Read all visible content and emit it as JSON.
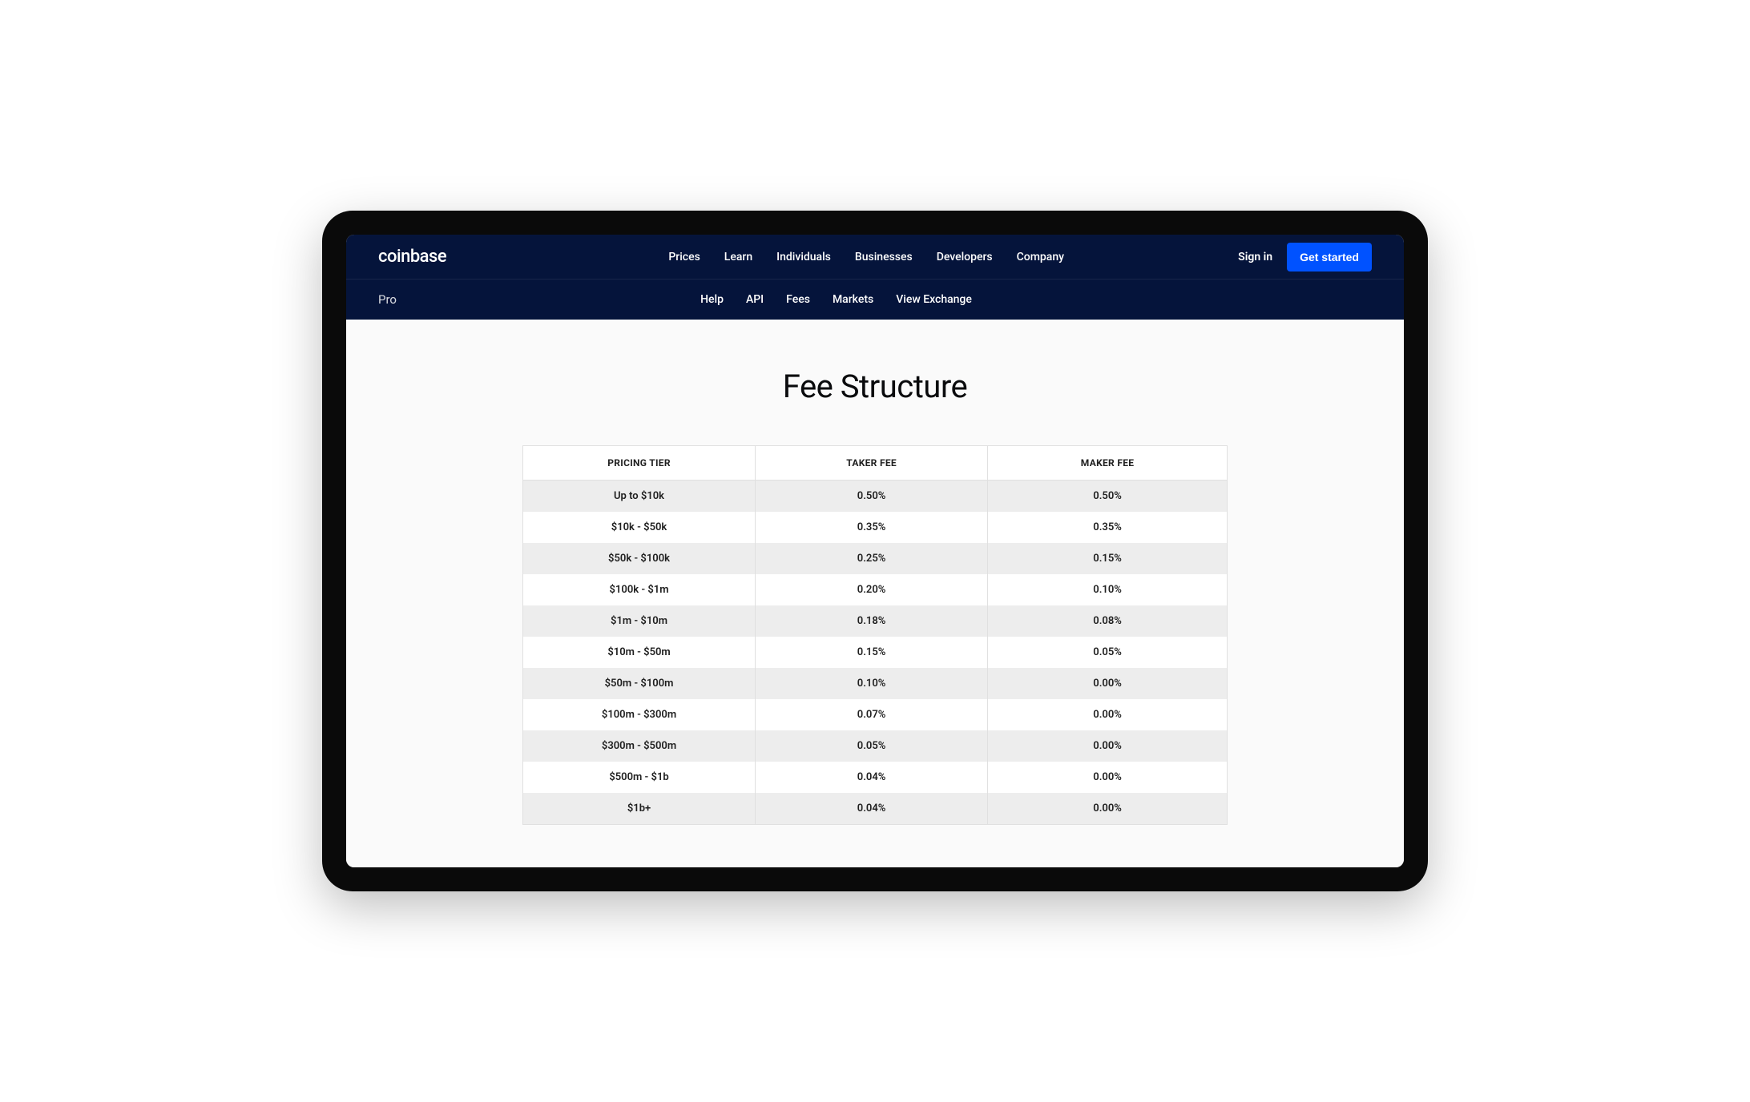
{
  "brand": "coinbase",
  "topNav": {
    "items": [
      {
        "label": "Prices"
      },
      {
        "label": "Learn"
      },
      {
        "label": "Individuals"
      },
      {
        "label": "Businesses"
      },
      {
        "label": "Developers"
      },
      {
        "label": "Company"
      }
    ],
    "signIn": "Sign in",
    "getStarted": "Get started"
  },
  "subNav": {
    "section": "Pro",
    "items": [
      {
        "label": "Help"
      },
      {
        "label": "API"
      },
      {
        "label": "Fees"
      },
      {
        "label": "Markets"
      },
      {
        "label": "View Exchange"
      }
    ]
  },
  "page": {
    "title": "Fee Structure"
  },
  "feeTable": {
    "headers": {
      "tier": "PRICING TIER",
      "taker": "TAKER FEE",
      "maker": "MAKER FEE"
    },
    "rows": [
      {
        "tier": "Up to $10k",
        "taker": "0.50%",
        "maker": "0.50%"
      },
      {
        "tier": "$10k - $50k",
        "taker": "0.35%",
        "maker": "0.35%"
      },
      {
        "tier": "$50k - $100k",
        "taker": "0.25%",
        "maker": "0.15%"
      },
      {
        "tier": "$100k - $1m",
        "taker": "0.20%",
        "maker": "0.10%"
      },
      {
        "tier": "$1m - $10m",
        "taker": "0.18%",
        "maker": "0.08%"
      },
      {
        "tier": "$10m - $50m",
        "taker": "0.15%",
        "maker": "0.05%"
      },
      {
        "tier": "$50m - $100m",
        "taker": "0.10%",
        "maker": "0.00%"
      },
      {
        "tier": "$100m - $300m",
        "taker": "0.07%",
        "maker": "0.00%"
      },
      {
        "tier": "$300m - $500m",
        "taker": "0.05%",
        "maker": "0.00%"
      },
      {
        "tier": "$500m - $1b",
        "taker": "0.04%",
        "maker": "0.00%"
      },
      {
        "tier": "$1b+",
        "taker": "0.04%",
        "maker": "0.00%"
      }
    ]
  }
}
